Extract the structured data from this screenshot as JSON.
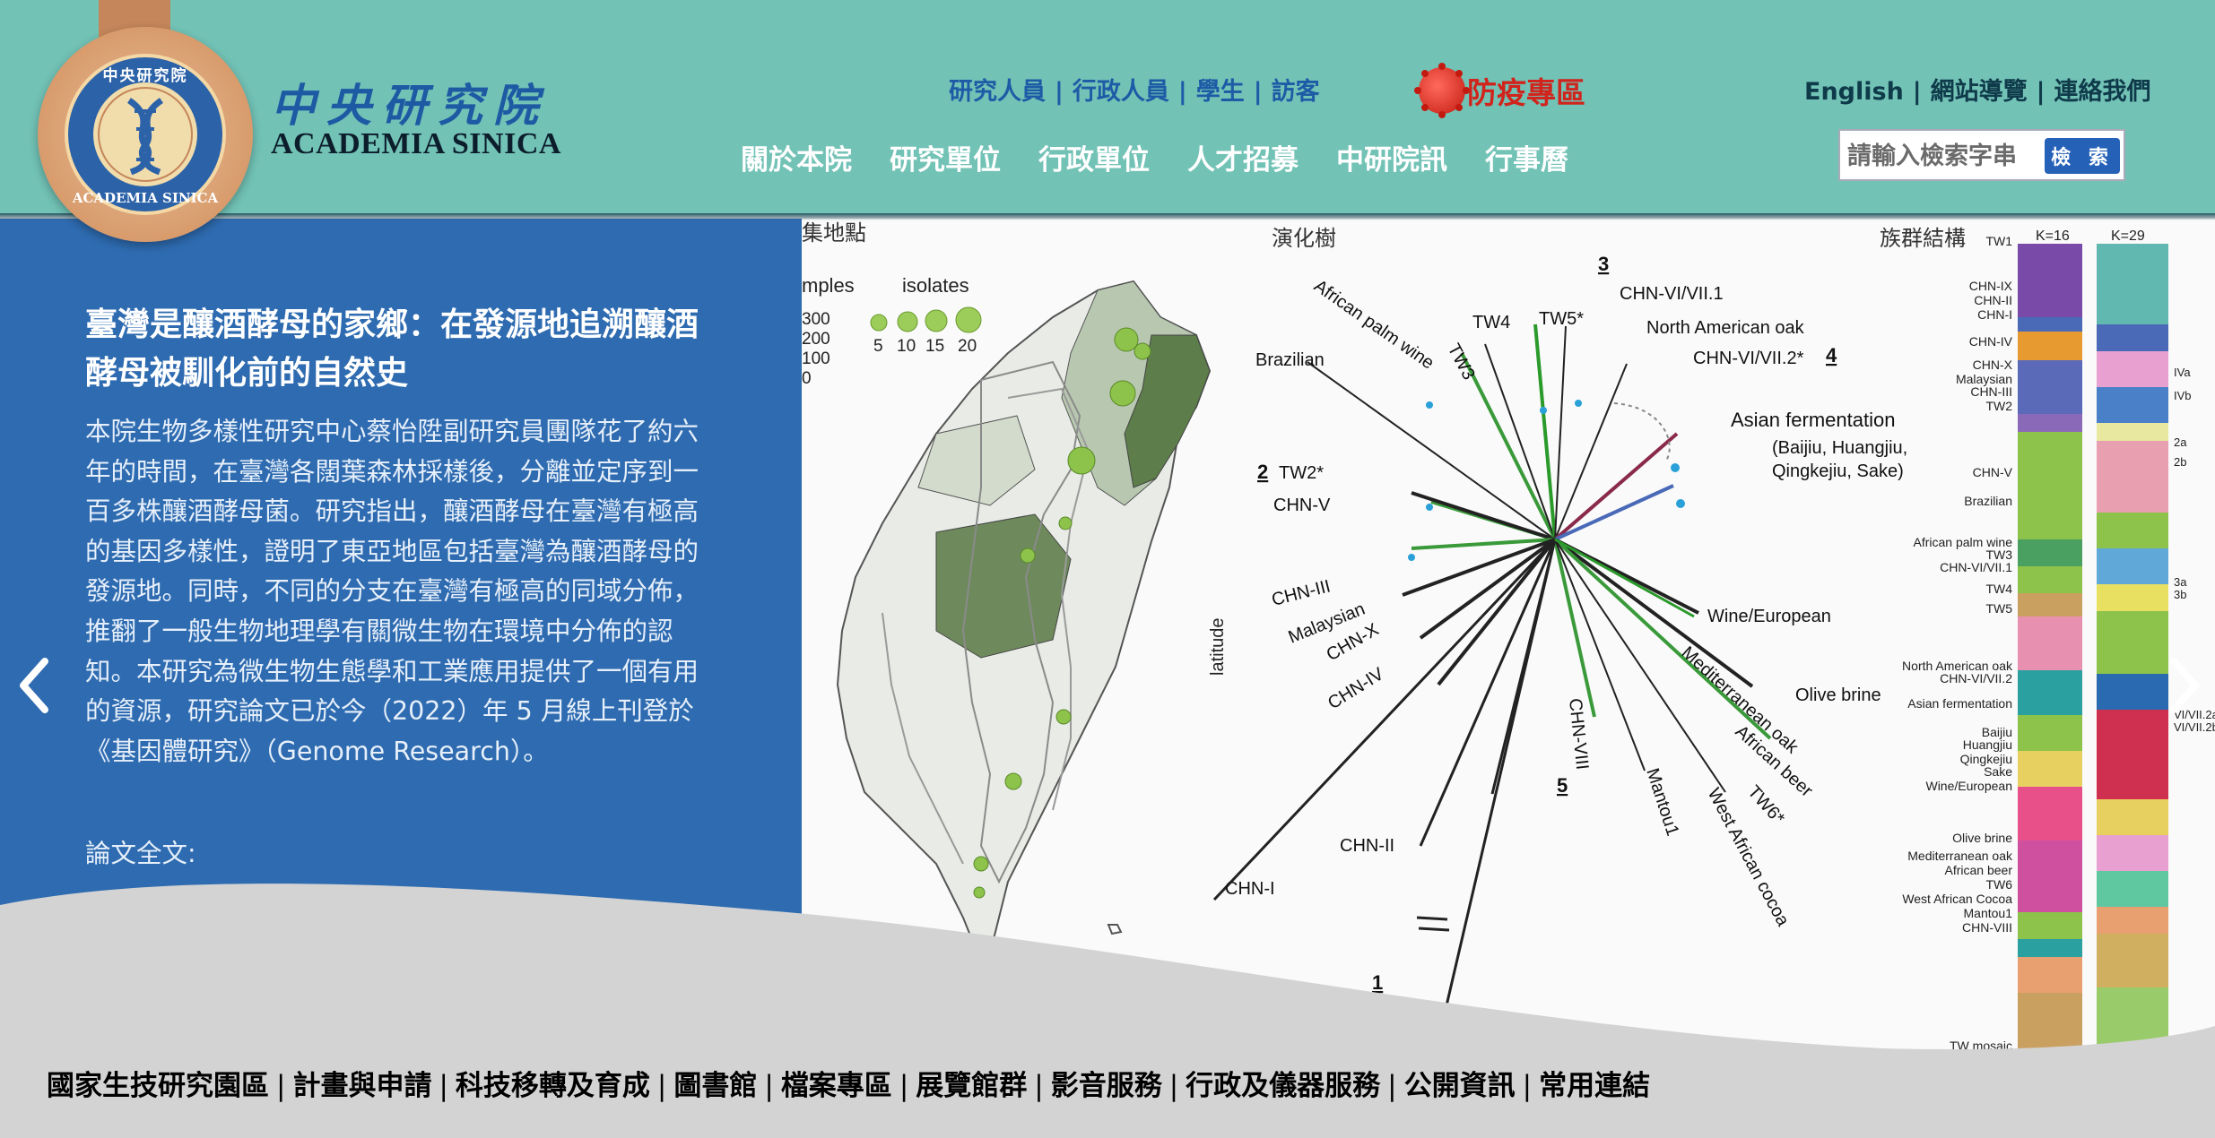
{
  "brand": {
    "name_zh": "中央研究院",
    "name_en": "ACADEMIA SINICA",
    "logo_ring_top": "中央研究院",
    "logo_ring_bottom": "ACADEMIA SINICA"
  },
  "audience_links": [
    "研究人員",
    "行政人員",
    "學生",
    "訪客"
  ],
  "pandemic": {
    "label": "防疫專區",
    "icon": "virus-icon"
  },
  "utility_links": [
    "English",
    "網站導覽",
    "連絡我們"
  ],
  "main_nav": [
    "關於本院",
    "研究單位",
    "行政單位",
    "人才招募",
    "中研院訊",
    "行事曆"
  ],
  "search": {
    "placeholder": "請輸入檢索字串",
    "button": "檢 索"
  },
  "article": {
    "title": "臺灣是釀酒酵母的家鄉：在發源地追溯釀酒酵母被馴化前的自然史",
    "body": "本院生物多樣性研究中心蔡怡陞副研究員團隊花了約六年的時間，在臺灣各闊葉森林採樣後，分離並定序到一百多株釀酒酵母菌。研究指出，釀酒酵母在臺灣有極高的基因多樣性，證明了東亞地區包括臺灣為釀酒酵母的發源地。同時，不同的分支在臺灣有極高的同域分佈，推翻了一般生物地理學有關微生物在環境中分佈的認知。本研究為微生物生態學和工業應用提供了一個有用的資源，研究論文已於今（2022）年 5 月線上刊登於《基因體研究》（Genome Research）。",
    "more": "論文全文:"
  },
  "carousel": {
    "prev_icon": "chevron-left-icon",
    "next_icon": "chevron-right-icon"
  },
  "figure": {
    "map_title": "集地點",
    "tree_title": "演化樹",
    "structure_title": "族群結構",
    "legend_samples": "mples",
    "legend_isolates": "isolates",
    "sample_ticks": [
      "300",
      "200",
      "100",
      "0"
    ],
    "isolate_ticks": [
      "5",
      "10",
      "15",
      "20"
    ],
    "latitude_label": "latitude",
    "k_labels": [
      "K=16",
      "K=29"
    ],
    "clade_numbers": [
      "3",
      "4",
      "2",
      "5",
      "1"
    ],
    "tree_labels": [
      "African palm wine",
      "TW4",
      "TW5*",
      "CHN-VI/VII.1",
      "North American oak",
      "CHN-VI/VII.2*",
      "Brazilian",
      "TW3",
      "Asian fermentation",
      "(Baijiu, Huangjiu,",
      "Qingkejiu, Sake)",
      "TW2*",
      "CHN-V",
      "CHN-III",
      "Malaysian",
      "CHN-X",
      "CHN-IV",
      "Wine/European",
      "Olive brine",
      "Mediterranean oak",
      "African beer",
      "TW6*",
      "CHN-VIII",
      "Mantou1",
      "West African cocoa",
      "CHN-II",
      "CHN-I"
    ],
    "structure_labels": [
      "TW1",
      "CHN-IX",
      "CHN-II",
      "CHN-I",
      "CHN-IV",
      "CHN-X",
      "Malaysian",
      "CHN-III",
      "TW2",
      "CHN-V",
      "Brazilian",
      "African palm wine",
      "TW3",
      "CHN-VI/VII.1",
      "TW4",
      "TW5",
      "North American oak",
      "CHN-VI/VII.2",
      "Asian fermentation",
      "Baijiu",
      "Huangjiu",
      "Qingkejiu",
      "Sake",
      "Wine/European",
      "Olive brine",
      "Mediterranean oak",
      "African beer",
      "TW6",
      "West African Cocoa",
      "Mantou1",
      "CHN-VIII",
      "TW mosaic"
    ],
    "right_edge_labels": [
      "IVa",
      "IVb",
      "2a",
      "2b",
      "3a",
      "3b",
      "VI/VII.2a",
      "VI/VII.2b"
    ]
  },
  "footer_links": [
    "國家生技研究園區",
    "計畫與申請",
    "科技移轉及育成",
    "圖書館",
    "檔案專區",
    "展覽館群",
    "影音服務",
    "行政及儀器服務",
    "公開資訊",
    "常用連結"
  ],
  "colors": {
    "header": "#72c2b6",
    "panel": "#2e6bb0",
    "nav_link": "#1e5ba6",
    "pandemic": "#d0241c",
    "footer_bg": "#d3d3d3"
  }
}
